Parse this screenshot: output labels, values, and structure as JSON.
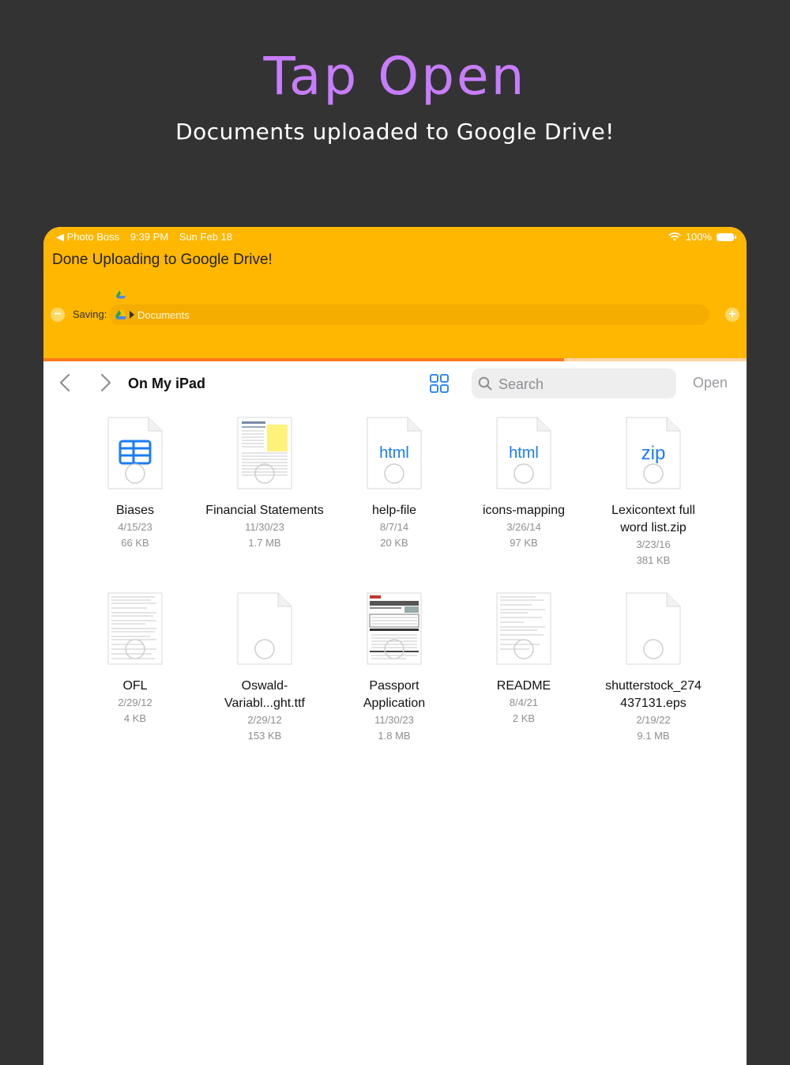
{
  "promo": {
    "headline": "Tap Open",
    "subline": "Documents uploaded to Google Drive!"
  },
  "status_bar": {
    "back_app": "◀ Photo Boss",
    "time": "9:39 PM",
    "date": "Sun Feb 18",
    "battery": "100%"
  },
  "banner": {
    "title": "Done Uploading to Google Drive!",
    "saving_label": "Saving:",
    "saving_path": "Documents",
    "upload_progress": 0.74
  },
  "navbar": {
    "title": "On My iPad",
    "search_placeholder": "Search",
    "open_label": "Open"
  },
  "files": [
    {
      "name": "Biases",
      "date": "4/15/23",
      "size": "66 KB",
      "icon": "spreadsheet-icon"
    },
    {
      "name": "Financial Statements",
      "date": "11/30/23",
      "size": "1.7 MB",
      "icon": "pdf-thumbnail"
    },
    {
      "name": "help-file",
      "date": "8/7/14",
      "size": "20 KB",
      "icon": "html-icon",
      "badge": "html"
    },
    {
      "name": "icons-mapping",
      "date": "3/26/14",
      "size": "97 KB",
      "icon": "html-icon",
      "badge": "html"
    },
    {
      "name": "Lexicontext full word list.zip",
      "date": "3/23/16",
      "size": "381 KB",
      "icon": "zip-icon",
      "badge": "zip"
    },
    {
      "name": "OFL",
      "date": "2/29/12",
      "size": "4 KB",
      "icon": "text-thumbnail"
    },
    {
      "name": "Oswald-Variabl...ght.ttf",
      "date": "2/29/12",
      "size": "153 KB",
      "icon": "blank-file-icon"
    },
    {
      "name": "Passport Application",
      "date": "11/30/23",
      "size": "1.8 MB",
      "icon": "form-thumbnail"
    },
    {
      "name": "README",
      "date": "8/4/21",
      "size": "2 KB",
      "icon": "text-thumbnail"
    },
    {
      "name": "shutterstock_274437131.eps",
      "date": "2/19/22",
      "size": "9.1 MB",
      "icon": "blank-file-icon"
    }
  ],
  "colors": {
    "headline": "#c77dff",
    "banner": "#ffb700",
    "progress": "#ff7a1a",
    "link_blue": "#1a7cf5"
  }
}
